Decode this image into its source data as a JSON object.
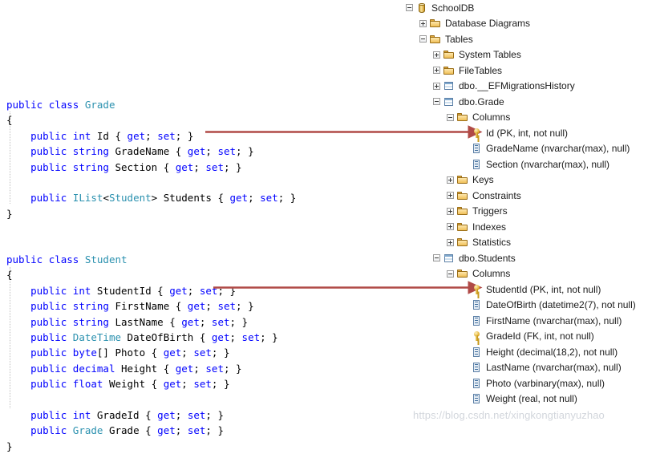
{
  "colors": {
    "keyword": "#0000ff",
    "type": "#2b91af",
    "text": "#000000",
    "arrow": "#b04a46",
    "watermark": "#d2d6dc",
    "background": "#ffffff"
  },
  "code": {
    "grade_class": {
      "title": "Grade",
      "lines": [
        [
          {
            "t": "public ",
            "c": "kw"
          },
          {
            "t": "class ",
            "c": "kw"
          },
          {
            "t": "Grade",
            "c": "type"
          }
        ],
        [
          {
            "t": "{",
            "c": "plain"
          }
        ],
        [
          {
            "t": "    ",
            "c": "plain"
          },
          {
            "t": "public ",
            "c": "kw"
          },
          {
            "t": "int ",
            "c": "kw"
          },
          {
            "t": "Id { ",
            "c": "plain"
          },
          {
            "t": "get",
            "c": "kw"
          },
          {
            "t": "; ",
            "c": "plain"
          },
          {
            "t": "set",
            "c": "kw"
          },
          {
            "t": "; }",
            "c": "plain"
          }
        ],
        [
          {
            "t": "    ",
            "c": "plain"
          },
          {
            "t": "public ",
            "c": "kw"
          },
          {
            "t": "string ",
            "c": "kw"
          },
          {
            "t": "GradeName { ",
            "c": "plain"
          },
          {
            "t": "get",
            "c": "kw"
          },
          {
            "t": "; ",
            "c": "plain"
          },
          {
            "t": "set",
            "c": "kw"
          },
          {
            "t": "; }",
            "c": "plain"
          }
        ],
        [
          {
            "t": "    ",
            "c": "plain"
          },
          {
            "t": "public ",
            "c": "kw"
          },
          {
            "t": "string ",
            "c": "kw"
          },
          {
            "t": "Section { ",
            "c": "plain"
          },
          {
            "t": "get",
            "c": "kw"
          },
          {
            "t": "; ",
            "c": "plain"
          },
          {
            "t": "set",
            "c": "kw"
          },
          {
            "t": "; }",
            "c": "plain"
          }
        ],
        [],
        [
          {
            "t": "    ",
            "c": "plain"
          },
          {
            "t": "public ",
            "c": "kw"
          },
          {
            "t": "IList",
            "c": "type"
          },
          {
            "t": "<",
            "c": "plain"
          },
          {
            "t": "Student",
            "c": "type"
          },
          {
            "t": "> Students { ",
            "c": "plain"
          },
          {
            "t": "get",
            "c": "kw"
          },
          {
            "t": "; ",
            "c": "plain"
          },
          {
            "t": "set",
            "c": "kw"
          },
          {
            "t": "; }",
            "c": "plain"
          }
        ],
        [
          {
            "t": "}",
            "c": "plain"
          }
        ]
      ]
    },
    "student_class": {
      "title": "Student",
      "lines": [
        [
          {
            "t": "public ",
            "c": "kw"
          },
          {
            "t": "class ",
            "c": "kw"
          },
          {
            "t": "Student",
            "c": "type"
          }
        ],
        [
          {
            "t": "{",
            "c": "plain"
          }
        ],
        [
          {
            "t": "    ",
            "c": "plain"
          },
          {
            "t": "public ",
            "c": "kw"
          },
          {
            "t": "int ",
            "c": "kw"
          },
          {
            "t": "StudentId { ",
            "c": "plain"
          },
          {
            "t": "get",
            "c": "kw"
          },
          {
            "t": "; ",
            "c": "plain"
          },
          {
            "t": "set",
            "c": "kw"
          },
          {
            "t": "; }",
            "c": "plain"
          }
        ],
        [
          {
            "t": "    ",
            "c": "plain"
          },
          {
            "t": "public ",
            "c": "kw"
          },
          {
            "t": "string ",
            "c": "kw"
          },
          {
            "t": "FirstName { ",
            "c": "plain"
          },
          {
            "t": "get",
            "c": "kw"
          },
          {
            "t": "; ",
            "c": "plain"
          },
          {
            "t": "set",
            "c": "kw"
          },
          {
            "t": "; }",
            "c": "plain"
          }
        ],
        [
          {
            "t": "    ",
            "c": "plain"
          },
          {
            "t": "public ",
            "c": "kw"
          },
          {
            "t": "string ",
            "c": "kw"
          },
          {
            "t": "LastName { ",
            "c": "plain"
          },
          {
            "t": "get",
            "c": "kw"
          },
          {
            "t": "; ",
            "c": "plain"
          },
          {
            "t": "set",
            "c": "kw"
          },
          {
            "t": "; }",
            "c": "plain"
          }
        ],
        [
          {
            "t": "    ",
            "c": "plain"
          },
          {
            "t": "public ",
            "c": "kw"
          },
          {
            "t": "DateTime",
            "c": "type"
          },
          {
            "t": " DateOfBirth { ",
            "c": "plain"
          },
          {
            "t": "get",
            "c": "kw"
          },
          {
            "t": "; ",
            "c": "plain"
          },
          {
            "t": "set",
            "c": "kw"
          },
          {
            "t": "; }",
            "c": "plain"
          }
        ],
        [
          {
            "t": "    ",
            "c": "plain"
          },
          {
            "t": "public ",
            "c": "kw"
          },
          {
            "t": "byte",
            "c": "kw"
          },
          {
            "t": "[] Photo { ",
            "c": "plain"
          },
          {
            "t": "get",
            "c": "kw"
          },
          {
            "t": "; ",
            "c": "plain"
          },
          {
            "t": "set",
            "c": "kw"
          },
          {
            "t": "; }",
            "c": "plain"
          }
        ],
        [
          {
            "t": "    ",
            "c": "plain"
          },
          {
            "t": "public ",
            "c": "kw"
          },
          {
            "t": "decimal ",
            "c": "kw"
          },
          {
            "t": "Height { ",
            "c": "plain"
          },
          {
            "t": "get",
            "c": "kw"
          },
          {
            "t": "; ",
            "c": "plain"
          },
          {
            "t": "set",
            "c": "kw"
          },
          {
            "t": "; }",
            "c": "plain"
          }
        ],
        [
          {
            "t": "    ",
            "c": "plain"
          },
          {
            "t": "public ",
            "c": "kw"
          },
          {
            "t": "float ",
            "c": "kw"
          },
          {
            "t": "Weight { ",
            "c": "plain"
          },
          {
            "t": "get",
            "c": "kw"
          },
          {
            "t": "; ",
            "c": "plain"
          },
          {
            "t": "set",
            "c": "kw"
          },
          {
            "t": "; }",
            "c": "plain"
          }
        ],
        [],
        [
          {
            "t": "    ",
            "c": "plain"
          },
          {
            "t": "public ",
            "c": "kw"
          },
          {
            "t": "int ",
            "c": "kw"
          },
          {
            "t": "GradeId { ",
            "c": "plain"
          },
          {
            "t": "get",
            "c": "kw"
          },
          {
            "t": "; ",
            "c": "plain"
          },
          {
            "t": "set",
            "c": "kw"
          },
          {
            "t": "; }",
            "c": "plain"
          }
        ],
        [
          {
            "t": "    ",
            "c": "plain"
          },
          {
            "t": "public ",
            "c": "kw"
          },
          {
            "t": "Grade",
            "c": "type"
          },
          {
            "t": " Grade { ",
            "c": "plain"
          },
          {
            "t": "get",
            "c": "kw"
          },
          {
            "t": "; ",
            "c": "plain"
          },
          {
            "t": "set",
            "c": "kw"
          },
          {
            "t": "; }",
            "c": "plain"
          }
        ],
        [
          {
            "t": "}",
            "c": "plain"
          }
        ]
      ]
    }
  },
  "tree": {
    "root_label": "SchoolDB",
    "nodes": [
      {
        "label": "SchoolDB",
        "icon": "database",
        "state": "minus",
        "depth": 0
      },
      {
        "label": "Database Diagrams",
        "icon": "folder",
        "state": "plus",
        "depth": 1
      },
      {
        "label": "Tables",
        "icon": "folder",
        "state": "minus",
        "depth": 1
      },
      {
        "label": "System Tables",
        "icon": "folder",
        "state": "plus",
        "depth": 2
      },
      {
        "label": "FileTables",
        "icon": "folder",
        "state": "plus",
        "depth": 2
      },
      {
        "label": "dbo.__EFMigrationsHistory",
        "icon": "table",
        "state": "plus",
        "depth": 2
      },
      {
        "label": "dbo.Grade",
        "icon": "table",
        "state": "minus",
        "depth": 2
      },
      {
        "label": "Columns",
        "icon": "folder",
        "state": "minus",
        "depth": 3
      },
      {
        "label": "Id (PK, int, not null)",
        "icon": "key",
        "state": "none",
        "depth": 4
      },
      {
        "label": "GradeName (nvarchar(max), null)",
        "icon": "column",
        "state": "none",
        "depth": 4
      },
      {
        "label": "Section (nvarchar(max), null)",
        "icon": "column",
        "state": "none",
        "depth": 4
      },
      {
        "label": "Keys",
        "icon": "folder",
        "state": "plus",
        "depth": 3
      },
      {
        "label": "Constraints",
        "icon": "folder",
        "state": "plus",
        "depth": 3
      },
      {
        "label": "Triggers",
        "icon": "folder",
        "state": "plus",
        "depth": 3
      },
      {
        "label": "Indexes",
        "icon": "folder",
        "state": "plus",
        "depth": 3
      },
      {
        "label": "Statistics",
        "icon": "folder",
        "state": "plus",
        "depth": 3
      },
      {
        "label": "dbo.Students",
        "icon": "table",
        "state": "minus",
        "depth": 2
      },
      {
        "label": "Columns",
        "icon": "folder",
        "state": "minus",
        "depth": 3
      },
      {
        "label": "StudentId (PK, int, not null)",
        "icon": "key",
        "state": "none",
        "depth": 4
      },
      {
        "label": "DateOfBirth (datetime2(7), not null)",
        "icon": "column",
        "state": "none",
        "depth": 4
      },
      {
        "label": "FirstName (nvarchar(max), null)",
        "icon": "column",
        "state": "none",
        "depth": 4
      },
      {
        "label": "GradeId (FK, int, not null)",
        "icon": "key",
        "state": "none",
        "depth": 4
      },
      {
        "label": "Height (decimal(18,2), not null)",
        "icon": "column",
        "state": "none",
        "depth": 4
      },
      {
        "label": "LastName (nvarchar(max), null)",
        "icon": "column",
        "state": "none",
        "depth": 4
      },
      {
        "label": "Photo (varbinary(max), null)",
        "icon": "column",
        "state": "none",
        "depth": 4
      },
      {
        "label": "Weight (real, not null)",
        "icon": "column",
        "state": "none",
        "depth": 4
      }
    ]
  },
  "annotations": {
    "arrows": [
      {
        "name": "grade-id-mapping-arrow",
        "from": "Grade.Id property",
        "to": "Id (PK, int, not null) column",
        "length": 348
      },
      {
        "name": "student-id-mapping-arrow",
        "from": "Student.StudentId property",
        "to": "StudentId (PK, int, not null) column",
        "length": 338
      }
    ]
  },
  "watermark": {
    "text": "https://blog.csdn.net/xingkongtianyuzhao"
  }
}
